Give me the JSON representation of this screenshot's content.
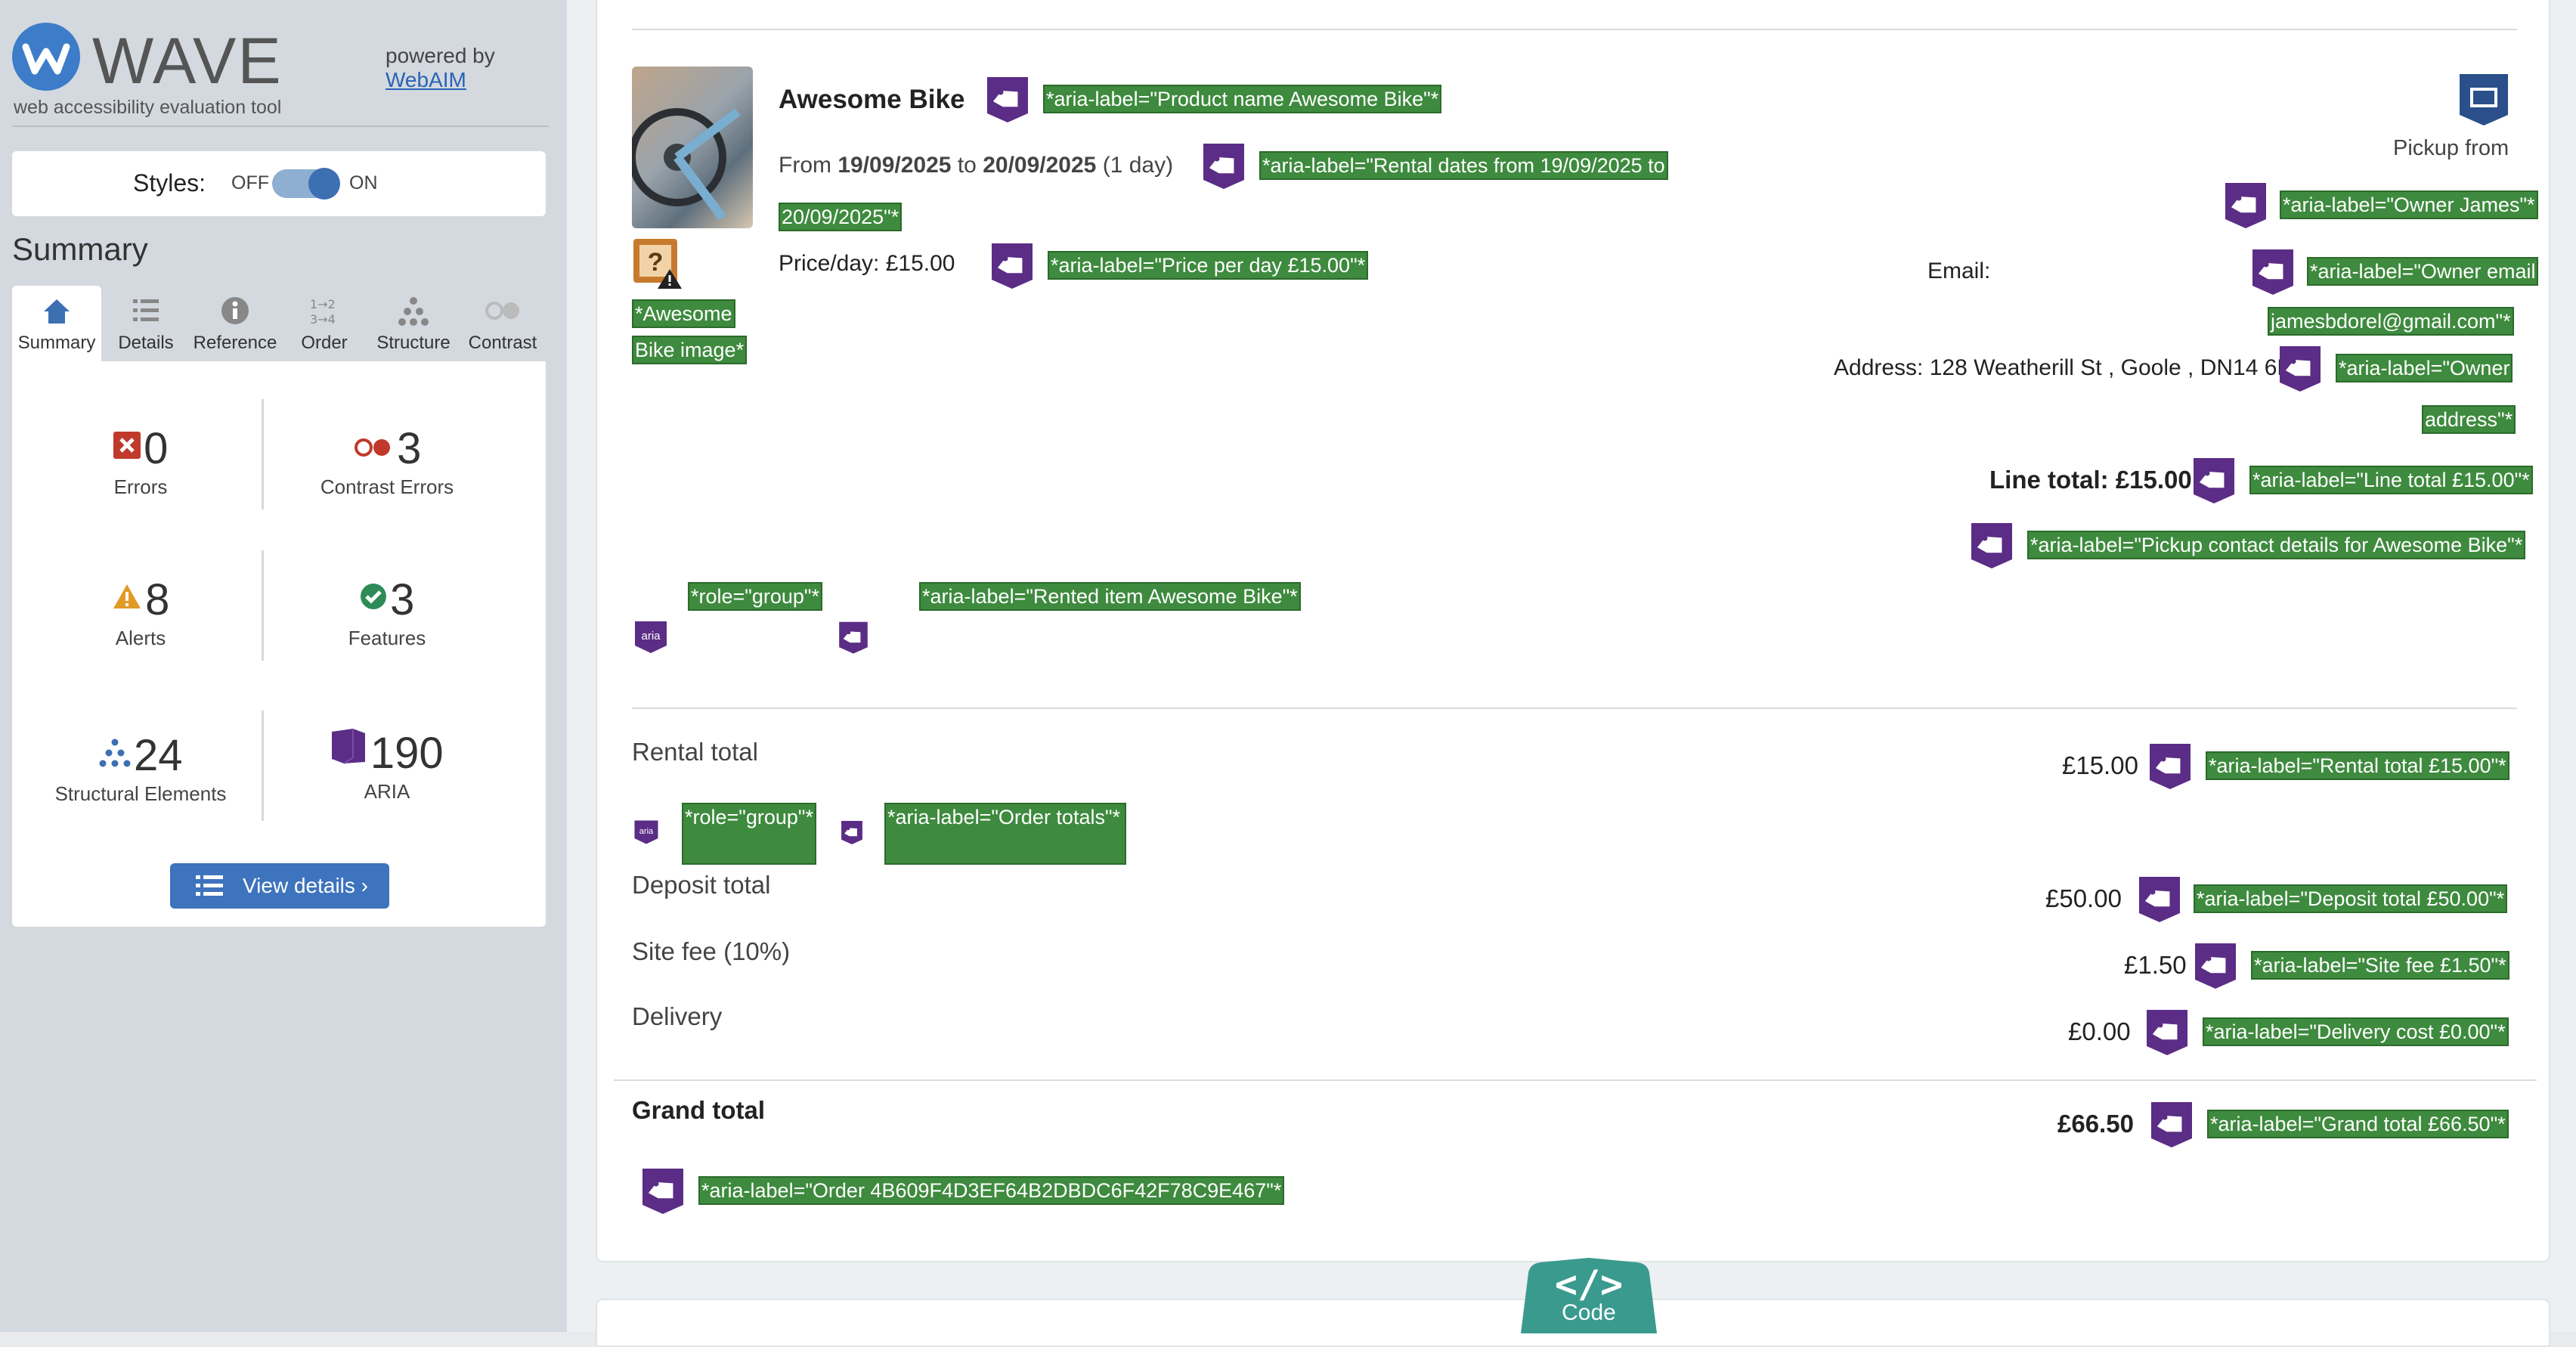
{
  "wave": {
    "logo_text": "WAVE",
    "tagline": "web accessibility evaluation tool",
    "powered_by": "powered by",
    "webaim_link": "WebAIM",
    "styles_label": "Styles:",
    "toggle_off": "OFF",
    "toggle_on": "ON",
    "summary_title": "Summary",
    "tabs": [
      {
        "label": "Summary",
        "icon": "home-icon"
      },
      {
        "label": "Details",
        "icon": "list-icon"
      },
      {
        "label": "Reference",
        "icon": "info-icon"
      },
      {
        "label": "Order",
        "icon": "order-icon"
      },
      {
        "label": "Structure",
        "icon": "structure-icon"
      },
      {
        "label": "Contrast",
        "icon": "contrast-icon"
      }
    ],
    "stats": {
      "errors": {
        "value": "0",
        "label": "Errors"
      },
      "contrast": {
        "value": "3",
        "label": "Contrast Errors"
      },
      "alerts": {
        "value": "8",
        "label": "Alerts"
      },
      "features": {
        "value": "3",
        "label": "Features"
      },
      "structural": {
        "value": "24",
        "label": "Structural Elements"
      },
      "aria": {
        "value": "190",
        "label": "ARIA"
      }
    },
    "view_details": "View details ›"
  },
  "item": {
    "name": "Awesome Bike",
    "name_aria": "*aria-label=\"Product name Awesome Bike\"*",
    "dates_prefix": "From",
    "date_from": "19/09/2025",
    "dates_to": "to",
    "date_to": "20/09/2025",
    "duration": "(1 day)",
    "dates_aria_1": "*aria-label=\"Rental dates from 19/09/2025 to",
    "dates_aria_2": "20/09/2025\"*",
    "price": "Price/day: £15.00",
    "price_aria": "*aria-label=\"Price per day £15.00\"*",
    "image_alt_1": "*Awesome",
    "image_alt_2": "Bike image*",
    "pickup_from": "Pickup from",
    "owner_aria": "*aria-label=\"Owner James\"*",
    "email_label": "Email:",
    "email_aria_1": "*aria-label=\"Owner email",
    "email_aria_2": "jamesbdorel@gmail.com\"*",
    "address": "Address: 128 Weatherill St , Goole , DN14 6ED",
    "address_aria_1": "*aria-label=\"Owner",
    "address_aria_2": "address\"*",
    "line_total": "Line total: £15.00",
    "line_total_aria": "*aria-label=\"Line total £15.00\"*",
    "pickup_aria": "*aria-label=\"Pickup contact details for Awesome Bike\"*",
    "group_role": "*role=\"group\"*",
    "rented_aria": "*aria-label=\"Rented item Awesome Bike\"*"
  },
  "totals": {
    "rental_label": "Rental total",
    "rental_value": "£15.00",
    "rental_aria": "*aria-label=\"Rental total £15.00\"*",
    "group_role": "*role=\"group\"*",
    "order_totals_aria": "*aria-label=\"Order totals\"*",
    "deposit_label": "Deposit total",
    "deposit_value": "£50.00",
    "deposit_aria": "*aria-label=\"Deposit total £50.00\"*",
    "fee_label": "Site fee (10%)",
    "fee_value": "£1.50",
    "fee_aria": "*aria-label=\"Site fee £1.50\"*",
    "delivery_label": "Delivery",
    "delivery_value": "£0.00",
    "delivery_aria": "*aria-label=\"Delivery cost £0.00\"*",
    "grand_label": "Grand total",
    "grand_value": "£66.50",
    "grand_aria": "*aria-label=\"Grand total £66.50\"*",
    "order_aria": "*aria-label=\"Order 4B609F4D3EF64B2DBDC6F42F78C9E467\"*"
  },
  "code_button": {
    "symbol": "</>",
    "label": "Code"
  },
  "colors": {
    "aria_tag": "#3e8a3e",
    "aria_icon": "#5b2d86",
    "wave_blue": "#3d7cc9"
  }
}
